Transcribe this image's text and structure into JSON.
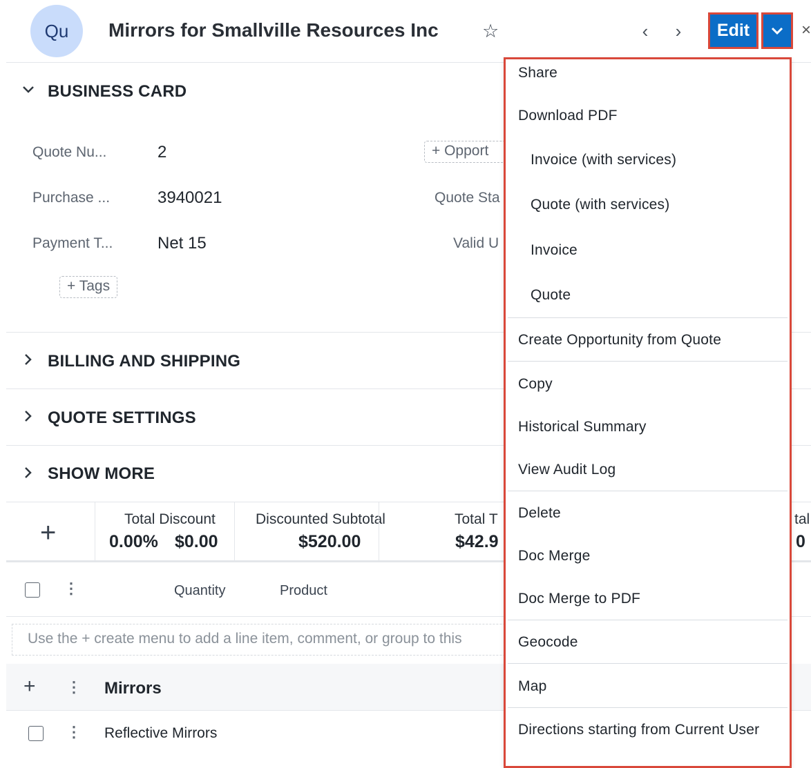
{
  "header": {
    "avatar": "Qu",
    "title": "Mirrors for Smallville Resources Inc",
    "edit_label": "Edit"
  },
  "sections": {
    "business_card": "BUSINESS CARD",
    "billing": "BILLING AND SHIPPING",
    "quote_settings": "QUOTE SETTINGS",
    "show_more": "SHOW MORE"
  },
  "fields": [
    {
      "label": "Quote Nu...",
      "value": "2"
    },
    {
      "label": "Purchase ...",
      "value": "3940021"
    },
    {
      "label": "Payment T...",
      "value": "Net 15"
    }
  ],
  "right_fields": {
    "opportunity_btn": "+ Opport",
    "quote_stage": "Quote Sta",
    "valid_until": "Valid U"
  },
  "tags_btn": "+ Tags",
  "totals": {
    "add_icon": "+",
    "discount_label": "Total Discount",
    "discount_pct": "0.00%",
    "discount_amt": "$0.00",
    "subtotal_label": "Discounted Subtotal",
    "subtotal_value": "$520.00",
    "tax_label": "Total T",
    "tax_value": "$42.9",
    "grand_label": "tal",
    "grand_value": "0"
  },
  "columns": {
    "quantity": "Quantity",
    "product": "Product"
  },
  "hint_text": "Use the + create menu to add a line item, comment, or group to this",
  "group": {
    "name": "Mirrors"
  },
  "line_item": {
    "name": "Reflective Mirrors"
  },
  "menu": {
    "items": [
      {
        "label": "Share",
        "sub": false
      },
      {
        "label": "Download PDF",
        "sub": false
      },
      {
        "label": "Invoice (with services)",
        "sub": true
      },
      {
        "label": "Quote (with services)",
        "sub": true
      },
      {
        "label": "Invoice",
        "sub": true
      },
      {
        "label": "Quote",
        "sub": true
      },
      {
        "label": "Create Opportunity from Quote",
        "sub": false
      },
      {
        "label": "Copy",
        "sub": false
      },
      {
        "label": "Historical Summary",
        "sub": false
      },
      {
        "label": "View Audit Log",
        "sub": false
      },
      {
        "label": "Delete",
        "sub": false
      },
      {
        "label": "Doc Merge",
        "sub": false
      },
      {
        "label": "Doc Merge to PDF",
        "sub": false
      },
      {
        "label": "Geocode",
        "sub": false
      },
      {
        "label": "Map",
        "sub": false
      },
      {
        "label": "Directions starting from Current User",
        "sub": false
      }
    ]
  },
  "colors": {
    "primary": "#0b6dc7",
    "highlight": "#d9483a",
    "avatar_bg": "#c9dcfb"
  }
}
